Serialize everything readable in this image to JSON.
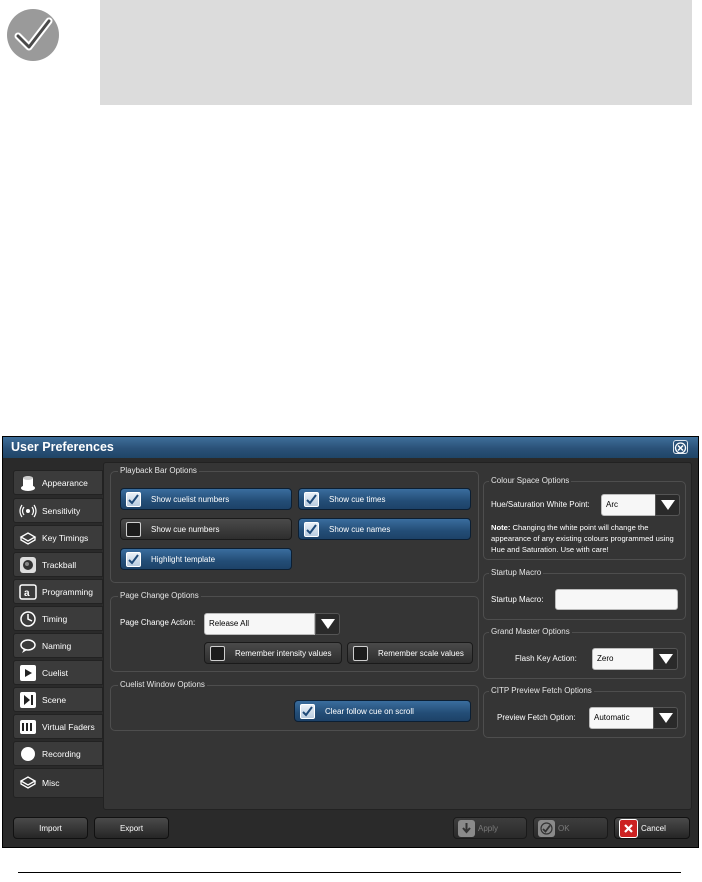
{
  "window": {
    "title": "User Preferences"
  },
  "sidebar": {
    "items": [
      {
        "label": "Appearance",
        "icon": "appearance-icon"
      },
      {
        "label": "Sensitivity",
        "icon": "sensitivity-icon"
      },
      {
        "label": "Key Timings",
        "icon": "key-timings-icon"
      },
      {
        "label": "Trackball",
        "icon": "trackball-icon"
      },
      {
        "label": "Programming",
        "icon": "programming-icon"
      },
      {
        "label": "Timing",
        "icon": "timing-icon"
      },
      {
        "label": "Naming",
        "icon": "naming-icon"
      },
      {
        "label": "Cuelist",
        "icon": "cuelist-icon"
      },
      {
        "label": "Scene",
        "icon": "scene-icon"
      },
      {
        "label": "Virtual Faders",
        "icon": "virtual-faders-icon"
      },
      {
        "label": "Recording",
        "icon": "recording-icon"
      },
      {
        "label": "Misc",
        "icon": "misc-icon"
      }
    ],
    "active": "Misc"
  },
  "playback_bar": {
    "title": "Playback Bar Options",
    "options": [
      {
        "label": "Show cuelist numbers",
        "checked": true
      },
      {
        "label": "Show cue times",
        "checked": true
      },
      {
        "label": "Show cue numbers",
        "checked": false
      },
      {
        "label": "Show cue names",
        "checked": true
      },
      {
        "label": "Highlight template",
        "checked": true
      }
    ]
  },
  "page_change": {
    "title": "Page Change Options",
    "action_label": "Page Change Action:",
    "action_value": "Release All",
    "remember_intensity": {
      "label": "Remember intensity values",
      "checked": false
    },
    "remember_scale": {
      "label": "Remember scale values",
      "checked": false
    }
  },
  "cuelist_window": {
    "title": "Cuelist Window Options",
    "clear_follow": {
      "label": "Clear follow cue on scroll",
      "checked": true
    }
  },
  "colour_space": {
    "title": "Colour Space Options",
    "white_point_label": "Hue/Saturation White Point:",
    "white_point_value": "Arc",
    "note_bold": "Note:",
    "note_text": "Changing the white point will change the appearance of any existing colours programmed using Hue and Saturation. Use with care!"
  },
  "startup_macro": {
    "title": "Startup Macro",
    "label": "Startup Macro:",
    "value": ""
  },
  "grand_master": {
    "title": "Grand Master Options",
    "label": "Flash Key Action:",
    "value": "Zero"
  },
  "citp": {
    "title": "CITP Preview Fetch Options",
    "label": "Preview Fetch Option:",
    "value": "Automatic"
  },
  "footer": {
    "import": "Import",
    "export": "Export",
    "apply": "Apply",
    "ok": "OK",
    "cancel": "Cancel"
  },
  "colors": {
    "accent": "#2a5178",
    "panel": "#353535",
    "window": "#2a2a2a",
    "cancel": "#cc2222"
  }
}
